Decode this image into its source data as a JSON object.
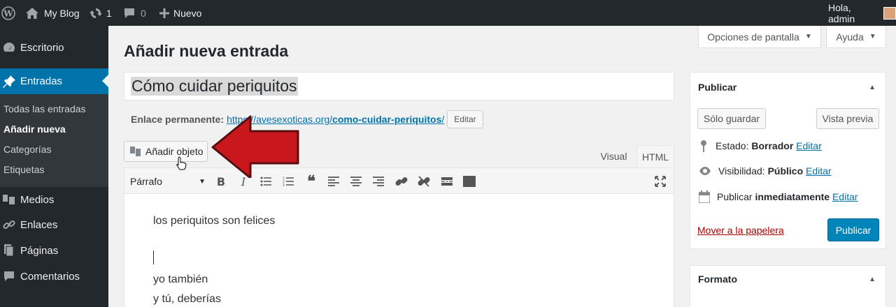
{
  "adminbar": {
    "site_name": "My Blog",
    "updates_count": "1",
    "comments_count": "0",
    "new_label": "Nuevo",
    "greeting": "Hola, admin"
  },
  "sidebar": {
    "items": [
      {
        "label": "Escritorio",
        "icon": "dashboard-icon"
      },
      {
        "label": "Entradas",
        "icon": "pin-icon"
      },
      {
        "label": "Medios",
        "icon": "media-icon"
      },
      {
        "label": "Enlaces",
        "icon": "link-icon"
      },
      {
        "label": "Páginas",
        "icon": "pages-icon"
      },
      {
        "label": "Comentarios",
        "icon": "comments-icon"
      }
    ],
    "submenu": [
      "Todas las entradas",
      "Añadir nueva",
      "Categorías",
      "Etiquetas"
    ]
  },
  "screen_options": {
    "label": "Opciones de pantalla",
    "help": "Ayuda"
  },
  "page_title": "Añadir nueva entrada",
  "post": {
    "title": "Cómo cuidar periquitos",
    "permalink_label": "Enlace permanente:",
    "permalink_base": "https://avesexoticas.org/",
    "permalink_slug": "como-cuidar-periquitos",
    "permalink_trailing": "/",
    "edit_label": "Editar"
  },
  "editor": {
    "add_media": "Añadir objeto",
    "tab_visual": "Visual",
    "tab_html": "HTML",
    "format": "Párrafo",
    "content": [
      "los periquitos son felices",
      "",
      "yo también",
      "y tú, deberías"
    ]
  },
  "publish": {
    "title": "Publicar",
    "save_draft": "Sólo guardar",
    "preview": "Vista previa",
    "status_label": "Estado:",
    "status_value": "Borrador",
    "visibility_label": "Visibilidad:",
    "visibility_value": "Público",
    "schedule_label": "Publicar",
    "schedule_value": "inmediatamente",
    "edit": "Editar",
    "trash": "Mover a la papelera",
    "publish_button": "Publicar"
  },
  "format_box": {
    "title": "Formato"
  },
  "colors": {
    "accent": "#0073aa",
    "sidebar": "#23282d",
    "arrow": "#c8171d"
  }
}
